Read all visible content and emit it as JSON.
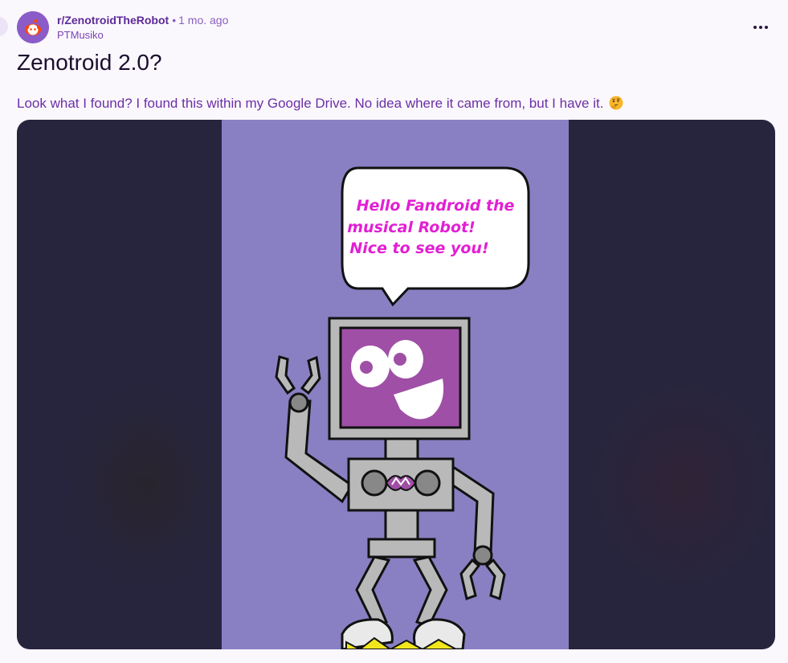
{
  "post": {
    "subreddit": "r/ZenotroidTheRobot",
    "separator": "•",
    "time_ago": "1 mo. ago",
    "author": "PTMusiko",
    "title": "Zenotroid 2.0?",
    "body": "Look what I found? I found this within my Google Drive. No idea where it came from, but I have it.",
    "emoji": "thinking-face-emoji"
  },
  "image": {
    "speech_lines": [
      "Hello Fandroid the",
      "musical Robot!",
      "Nice to see you!"
    ]
  },
  "icons": {
    "more": "more-options-icon",
    "avatar": "reddit-snoo-avatar"
  },
  "colors": {
    "subreddit": "#5d2a98",
    "body_text": "#6b2fa6",
    "art_bg": "#8880c2",
    "speech_text": "#e21fd3",
    "screen": "#9f4fa6",
    "robot_gray": "#b9b9b9"
  }
}
